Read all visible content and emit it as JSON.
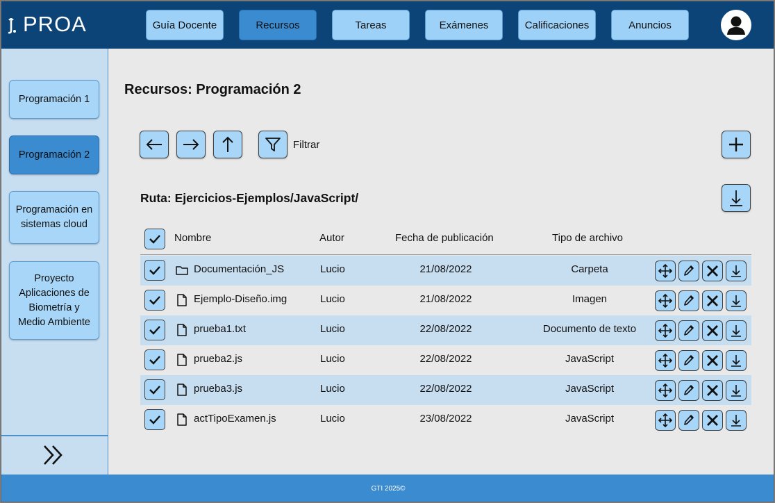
{
  "app": {
    "logo_text": "PROA"
  },
  "nav": [
    {
      "label": "Guía Docente"
    },
    {
      "label": "Recursos"
    },
    {
      "label": "Tareas"
    },
    {
      "label": "Exámenes"
    },
    {
      "label": "Calificaciones"
    },
    {
      "label": "Anuncios"
    }
  ],
  "nav_active": "Recursos",
  "sidebar": {
    "items": [
      {
        "label": "Programación 1"
      },
      {
        "label": "Programación 2"
      },
      {
        "label": "Programación en sistemas cloud"
      },
      {
        "label": "Proyecto Aplicaciones de Biometría y Medio Ambiente"
      }
    ],
    "active": "Programación 2"
  },
  "main": {
    "title": "Recursos: Programación 2",
    "filter_label": "Filtrar",
    "path": "Ruta: Ejercicios-Ejemplos/JavaScript/",
    "columns": [
      "Nombre",
      "Autor",
      "Fecha de publicación",
      "Tipo de archivo"
    ],
    "rows": [
      {
        "name": "Documentación_JS",
        "author": "Lucio",
        "date": "21/08/2022",
        "type": "Carpeta",
        "icon": "folder-icon"
      },
      {
        "name": "Ejemplo-Diseño.img",
        "author": "Lucio",
        "date": "21/08/2022",
        "type": "Imagen",
        "icon": "file-icon"
      },
      {
        "name": "prueba1.txt",
        "author": "Lucio",
        "date": "22/08/2022",
        "type": "Documento de texto",
        "icon": "file-icon"
      },
      {
        "name": "prueba2.js",
        "author": "Lucio",
        "date": "22/08/2022",
        "type": "JavaScript",
        "icon": "file-icon"
      },
      {
        "name": "prueba3.js",
        "author": "Lucio",
        "date": "22/08/2022",
        "type": "JavaScript",
        "icon": "file-icon"
      },
      {
        "name": "actTipoExamen.js",
        "author": "Lucio",
        "date": "23/08/2022",
        "type": "JavaScript",
        "icon": "file-icon"
      }
    ]
  },
  "footer": {
    "text": "GTI 2025©"
  },
  "colors": {
    "header": "#0d4477",
    "button": "#a7d6f8",
    "button_active": "#3b8bd1",
    "sidebar": "#c7ddf0",
    "row_shade": "#c7ddf0",
    "footer": "#3b8bd1"
  }
}
